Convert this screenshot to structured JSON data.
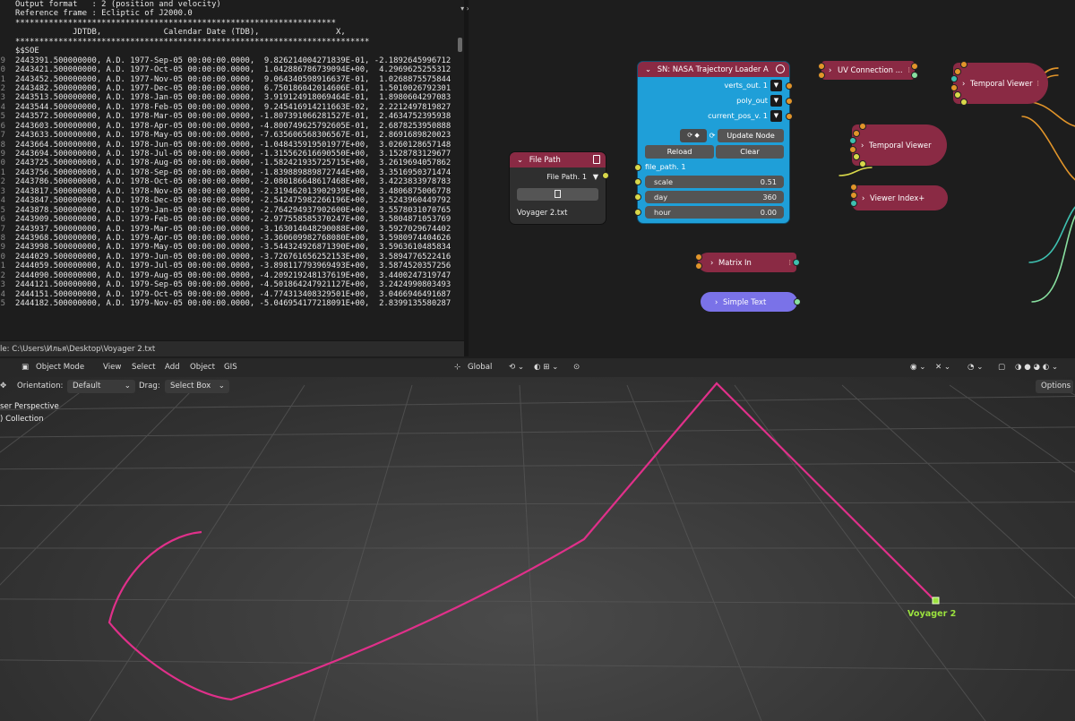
{
  "text_editor": {
    "lines": [
      {
        "num": "",
        "text": "Output format   : 2 (position and velocity)"
      },
      {
        "num": "",
        "text": "Reference frame : Ecliptic of J2000.0"
      },
      {
        "num": "",
        "text": "*******************************************************************"
      },
      {
        "num": "",
        "text": "            JDTDB,             Calendar Date (TDB),                X,"
      },
      {
        "num": "",
        "text": "**************************************************************************"
      },
      {
        "num": "",
        "text": "$$SOE"
      },
      {
        "num": "9",
        "text": "2443391.500000000, A.D. 1977-Sep-05 00:00:00.0000,  9.826214004271839E-01, -2.1892645996712"
      },
      {
        "num": "0",
        "text": "2443421.500000000, A.D. 1977-Oct-05 00:00:00.0000,  1.042886786739094E+00,  4.2969625255312"
      },
      {
        "num": "1",
        "text": "2443452.500000000, A.D. 1977-Nov-05 00:00:00.0000,  9.064340598916637E-01,  1.0268875575844"
      },
      {
        "num": "2",
        "text": "2443482.500000000, A.D. 1977-Dec-05 00:00:00.0000,  6.750186042014606E-01,  1.5010026792301"
      },
      {
        "num": "3",
        "text": "2443513.500000000, A.D. 1978-Jan-05 00:00:00.0000,  3.919124918069464E-01,  1.8980604297083"
      },
      {
        "num": "4",
        "text": "2443544.500000000, A.D. 1978-Feb-05 00:00:00.0000,  9.245416914211663E-02,  2.2212497819827"
      },
      {
        "num": "5",
        "text": "2443572.500000000, A.D. 1978-Mar-05 00:00:00.0000, -1.807391066281527E-01,  2.4634752395938"
      },
      {
        "num": "6",
        "text": "2443603.500000000, A.D. 1978-Apr-05 00:00:00.0000, -4.800749625792605E-01,  2.6878253950888"
      },
      {
        "num": "7",
        "text": "2443633.500000000, A.D. 1978-May-05 00:00:00.0000, -7.635606568306567E-01,  2.8691689820023"
      },
      {
        "num": "8",
        "text": "2443664.500000000, A.D. 1978-Jun-05 00:00:00.0000, -1.048435919501977E+00,  3.0260128657148"
      },
      {
        "num": "9",
        "text": "2443694.500000000, A.D. 1978-Jul-05 00:00:00.0000, -1.315562616690550E+00,  3.1528783129677"
      },
      {
        "num": "0",
        "text": "2443725.500000000, A.D. 1978-Aug-05 00:00:00.0000, -1.582421935725715E+00,  3.2619694057862"
      },
      {
        "num": "1",
        "text": "2443756.500000000, A.D. 1978-Sep-05 00:00:00.0000, -1.839889889872744E+00,  3.3516950371474"
      },
      {
        "num": "2",
        "text": "2443786.500000000, A.D. 1978-Oct-05 00:00:00.0000, -2.080186648617468E+00,  3.4223833978783"
      },
      {
        "num": "3",
        "text": "2443817.500000000, A.D. 1978-Nov-05 00:00:00.0000, -2.319462013902939E+00,  3.4806875006778"
      },
      {
        "num": "4",
        "text": "2443847.500000000, A.D. 1978-Dec-05 00:00:00.0000, -2.542475982266196E+00,  3.5243960449792"
      },
      {
        "num": "5",
        "text": "2443878.500000000, A.D. 1979-Jan-05 00:00:00.0000, -2.764294937902600E+00,  3.5578031070765"
      },
      {
        "num": "6",
        "text": "2443909.500000000, A.D. 1979-Feb-05 00:00:00.0000, -2.977558585370247E+00,  3.5804871053769"
      },
      {
        "num": "7",
        "text": "2443937.500000000, A.D. 1979-Mar-05 00:00:00.0000, -3.163014048290088E+00,  3.5927029674402"
      },
      {
        "num": "8",
        "text": "2443968.500000000, A.D. 1979-Apr-05 00:00:00.0000, -3.360609982768080E+00,  3.5980974404626"
      },
      {
        "num": "9",
        "text": "2443998.500000000, A.D. 1979-May-05 00:00:00.0000, -3.544324926871390E+00,  3.5963610485834"
      },
      {
        "num": "0",
        "text": "2444029.500000000, A.D. 1979-Jun-05 00:00:00.0000, -3.726761656252153E+00,  3.5894776522416"
      },
      {
        "num": "1",
        "text": "2444059.500000000, A.D. 1979-Jul-05 00:00:00.0000, -3.898117793969493E+00,  3.5874520357256"
      },
      {
        "num": "2",
        "text": "2444090.500000000, A.D. 1979-Aug-05 00:00:00.0000, -4.209219248137619E+00,  3.4400247319747"
      },
      {
        "num": "3",
        "text": "2444121.500000000, A.D. 1979-Sep-05 00:00:00.0000, -4.501864247921127E+00,  3.2424990803493"
      },
      {
        "num": "4",
        "text": "2444151.500000000, A.D. 1979-Oct-05 00:00:00.0000, -4.774313408329501E+00,  3.0466946491687"
      },
      {
        "num": "5",
        "text": "2444182.500000000, A.D. 1979-Nov-05 00:00:00.0000, -5.046954177218091E+00,  2.8399135580287"
      }
    ],
    "status": "le: C:\\Users\\Илья\\Desktop\\Voyager 2.txt"
  },
  "node_editor": {
    "file_path_node": {
      "title": "File Path",
      "output_label": "File Path. 1",
      "filename": "Voyager 2.txt"
    },
    "loader_node": {
      "title": "SN: NASA Trajectory Loader A",
      "outputs": [
        "verts_out. 1",
        "poly_out",
        "current_pos_v. 1"
      ],
      "update_button": "Update Node",
      "reload_button": "Reload",
      "clear_button": "Clear",
      "input_label": "file_path. 1",
      "fields": [
        {
          "label": "scale",
          "value": "0.51"
        },
        {
          "label": "day",
          "value": "360"
        },
        {
          "label": "hour",
          "value": "0.00"
        }
      ],
      "color": "#1f9fd8"
    },
    "uv_connection_node": {
      "title": "UV Connection ..."
    },
    "temporal_viewer_1": {
      "title": "Temporal Viewer"
    },
    "temporal_viewer_2": {
      "title": "Temporal Viewer"
    },
    "viewer_index_node": {
      "title": "Viewer Index+"
    },
    "matrix_in_node": {
      "title": "Matrix In"
    },
    "simple_text_node": {
      "title": "Simple Text"
    },
    "colors": {
      "node_header_red": "#8a2a44",
      "wire_orange": "#e2952a",
      "wire_yellow": "#d8d84a",
      "wire_teal": "#3ec0b0",
      "simple_text": "#7a72e8"
    }
  },
  "viewport": {
    "header": {
      "mode": "Object Mode",
      "menus": [
        "View",
        "Select",
        "Add",
        "Object",
        "GIS"
      ],
      "transform": "Global",
      "options_button": "Options"
    },
    "toolbar": {
      "orientation_label": "Orientation:",
      "orientation_value": "Default",
      "drag_label": "Drag:",
      "drag_value": "Select Box"
    },
    "overlay_lines": [
      "ser Perspective",
      ") Collection"
    ],
    "object_label": "Voyager 2",
    "trajectory_color": "#e0308a",
    "object_color": "#9be23e"
  }
}
